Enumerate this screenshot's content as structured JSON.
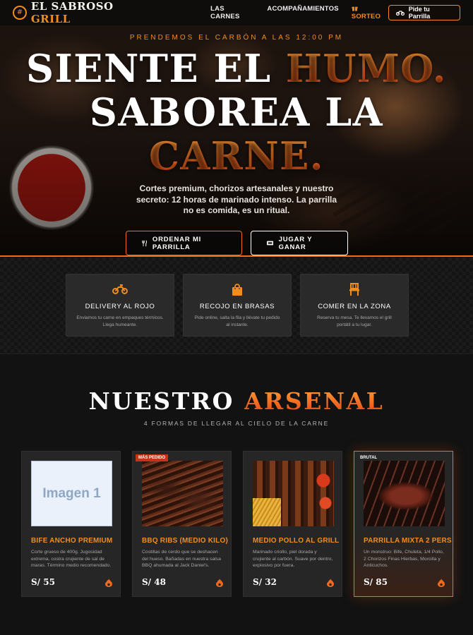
{
  "nav": {
    "brand_main": "EL SABROSO ",
    "brand_accent": "GRILL",
    "links": [
      {
        "label": "LAS CARNES"
      },
      {
        "label": "ACOMPAÑAMIENTOS"
      },
      {
        "label": "SORTEO"
      }
    ],
    "cta_label": "Pide tu Parrilla"
  },
  "hero": {
    "kicker": "PRENDEMOS EL CARBÓN A LAS 12:00 PM",
    "headline_1": "SIENTE EL ",
    "headline_1_accent": "HUMO.",
    "headline_2": "SABOREA LA",
    "headline_3_accent": "CARNE.",
    "subtitle": "Cortes premium, chorizos artesanales y nuestro secreto: 12 horas de marinado intenso. La parrilla no es comida, es un ritual.",
    "primary_btn": "ORDENAR MI PARRILLA",
    "secondary_btn": "JUGAR Y GANAR"
  },
  "services": [
    {
      "icon": "motorcycle-icon",
      "title": "DELIVERY AL ROJO",
      "text": "Enviamos tu carne en empaques térmicos. Llega humeante."
    },
    {
      "icon": "shopping-bag-icon",
      "title": "RECOJO EN BRASAS",
      "text": "Pide online, salta la fila y llévate tu pedido al instante."
    },
    {
      "icon": "chair-icon",
      "title": "COMER EN LA ZONA",
      "text": "Reserva tu mesa. Te llevamos el grill portátil a tu lugar."
    }
  ],
  "arsenal": {
    "title": "NUESTRO ",
    "title_accent": "ARSENAL",
    "subtitle": "4 FORMAS DE LLEGAR AL CIELO DE LA CARNE"
  },
  "products": [
    {
      "badge": "",
      "image_label": "Imagen 1",
      "title": "BIFE ANCHO PREMIUM",
      "desc": "Corte grueso de 400g. Jugosidad extrema, costra crujiente de sal de maras. Término medio recomendado.",
      "price": "S/ 55"
    },
    {
      "badge": "MÁS PEDIDO",
      "image_label": "",
      "title": "BBQ RIBS (MEDIO KILO)",
      "desc": "Costillas de cerdo que se deshacen del hueso. Bañadas en nuestra salsa BBQ ahumada al Jack Daniel's.",
      "price": "S/ 48"
    },
    {
      "badge": "",
      "image_label": "",
      "title": "MEDIO POLLO AL GRILL",
      "desc": "Marinado criollo, piel dorada y crujiente al carbón. Suave por dentro, explosivo por fuera.",
      "price": "S/ 32"
    },
    {
      "badge": "BRUTAL",
      "image_label": "",
      "title": "PARRILLA MIXTA 2 PERS",
      "desc": "Un monstruo: Bife, Chuleta, 1/4 Pollo, 2 Chorizos Finas Hierbas, Morcilla y Anticuchos.",
      "price": "S/ 85"
    }
  ],
  "colors": {
    "accent": "#f28c1e",
    "accent_red": "#f26a1b",
    "background": "#121212",
    "card": "#262626"
  }
}
